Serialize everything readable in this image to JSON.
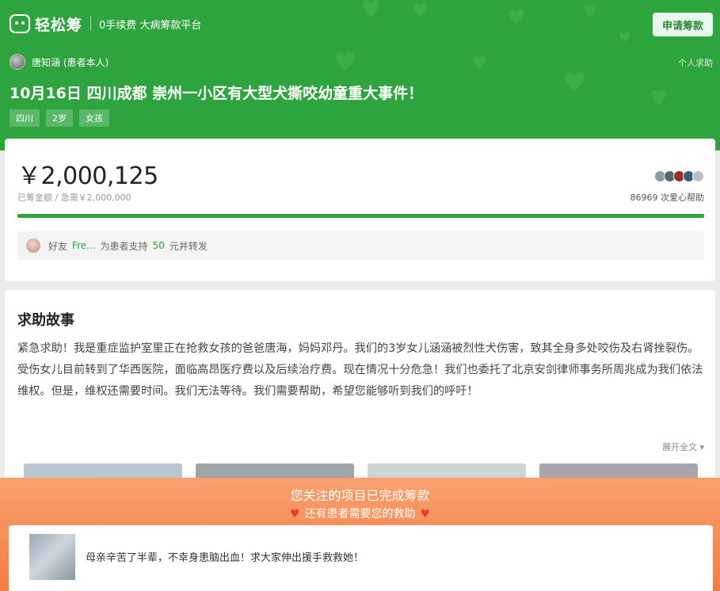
{
  "header": {
    "logo_text": "轻松筹",
    "slogan": "0手续费 大病筹款平台",
    "apply_button": "申请筹款",
    "user_name": "唐知涵 (患者本人)",
    "help_type": "个人求助",
    "title": "10月16日 四川成都 崇州一小区有大型犬撕咬幼童重大事件！",
    "tags": [
      "四川",
      "2岁",
      "女孩"
    ]
  },
  "funding": {
    "amount": "￥2,000,125",
    "target_text": "已筹金额 / 急需￥2,000,000",
    "donor_count": "86969",
    "donor_suffix": "次爱心帮助",
    "progress_fraction": 1.0,
    "donor_avatar_colors": [
      "#8a9aa6",
      "#4d6b63",
      "#9b2b2b",
      "#3c5a7a",
      "#b6bfc6"
    ],
    "friend_prefix": "好友",
    "friend_name": "Fre...",
    "friend_middle": "为患者支持",
    "friend_amount": "50",
    "friend_suffix": "元并转发"
  },
  "story": {
    "title": "求助故事",
    "text": "紧急求助！我是重症监护室里正在抢救女孩的爸爸唐海，妈妈邓丹。我们的3岁女儿涵涵被烈性犬伤害，致其全身多处咬伤及右肾挫裂伤。受伤女儿目前转到了华西医院，面临高昂医疗费以及后续治疗费。现在情况十分危急！我们也委托了北京安剑律师事务所周兆成为我们依法维权。但是，维权还需要时间。我们无法等待。我们需要帮助，希望您能够听到我们的呼吁！",
    "expand": "展开全文 ▾",
    "thumb_colors": [
      "#b9c6cf",
      "#9fa5a8",
      "#cfd3d6",
      "#a9a4ad"
    ]
  },
  "overlay": {
    "title": "您关注的项目已完成筹款",
    "subtitle": "还有患者需要您的救助",
    "heart": "♥",
    "recommend_text": "母亲辛苦了半辈，不幸身患脑出血！求大家伸出援手救救她！"
  },
  "colors": {
    "brand_green": "#2ea43e",
    "overlay_orange": "#f47d44",
    "heart_red": "#e8412b"
  }
}
